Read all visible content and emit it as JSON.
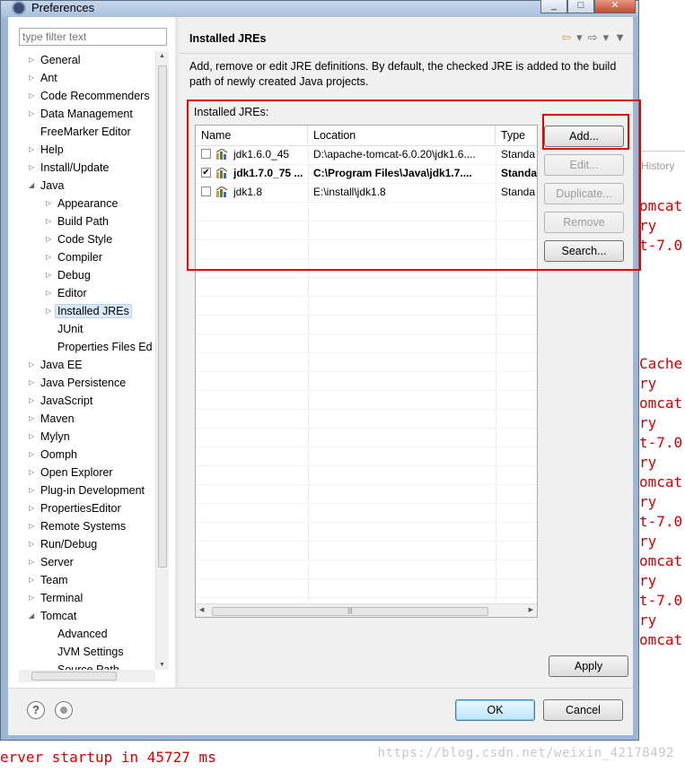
{
  "window": {
    "title": "Preferences"
  },
  "filter": {
    "placeholder": "type filter text"
  },
  "tree": {
    "items": [
      {
        "label": "General",
        "level": 0,
        "expandable": true
      },
      {
        "label": "Ant",
        "level": 0,
        "expandable": true
      },
      {
        "label": "Code Recommenders",
        "level": 0,
        "expandable": true
      },
      {
        "label": "Data Management",
        "level": 0,
        "expandable": true
      },
      {
        "label": "FreeMarker Editor",
        "level": 0,
        "expandable": false
      },
      {
        "label": "Help",
        "level": 0,
        "expandable": true
      },
      {
        "label": "Install/Update",
        "level": 0,
        "expandable": true
      },
      {
        "label": "Java",
        "level": 0,
        "expandable": true,
        "expanded": true
      },
      {
        "label": "Appearance",
        "level": 1,
        "expandable": true
      },
      {
        "label": "Build Path",
        "level": 1,
        "expandable": true
      },
      {
        "label": "Code Style",
        "level": 1,
        "expandable": true
      },
      {
        "label": "Compiler",
        "level": 1,
        "expandable": true
      },
      {
        "label": "Debug",
        "level": 1,
        "expandable": true
      },
      {
        "label": "Editor",
        "level": 1,
        "expandable": true
      },
      {
        "label": "Installed JREs",
        "level": 1,
        "expandable": true,
        "selected": true
      },
      {
        "label": "JUnit",
        "level": 1,
        "expandable": false
      },
      {
        "label": "Properties Files Ed",
        "level": 1,
        "expandable": false
      },
      {
        "label": "Java EE",
        "level": 0,
        "expandable": true
      },
      {
        "label": "Java Persistence",
        "level": 0,
        "expandable": true
      },
      {
        "label": "JavaScript",
        "level": 0,
        "expandable": true
      },
      {
        "label": "Maven",
        "level": 0,
        "expandable": true
      },
      {
        "label": "Mylyn",
        "level": 0,
        "expandable": true
      },
      {
        "label": "Oomph",
        "level": 0,
        "expandable": true
      },
      {
        "label": "Open Explorer",
        "level": 0,
        "expandable": true
      },
      {
        "label": "Plug-in Development",
        "level": 0,
        "expandable": true
      },
      {
        "label": "PropertiesEditor",
        "level": 0,
        "expandable": true
      },
      {
        "label": "Remote Systems",
        "level": 0,
        "expandable": true
      },
      {
        "label": "Run/Debug",
        "level": 0,
        "expandable": true
      },
      {
        "label": "Server",
        "level": 0,
        "expandable": true
      },
      {
        "label": "Team",
        "level": 0,
        "expandable": true
      },
      {
        "label": "Terminal",
        "level": 0,
        "expandable": true
      },
      {
        "label": "Tomcat",
        "level": 0,
        "expandable": true,
        "expanded": true
      },
      {
        "label": "Advanced",
        "level": 1,
        "expandable": false
      },
      {
        "label": "JVM Settings",
        "level": 1,
        "expandable": false
      },
      {
        "label": "Source Path",
        "level": 1,
        "expandable": false
      }
    ]
  },
  "page": {
    "title": "Installed JREs",
    "description": "Add, remove or edit JRE definitions. By default, the checked JRE is added to the build path of newly created Java projects.",
    "list_label": "Installed JREs:"
  },
  "table": {
    "headers": [
      "Name",
      "Location",
      "Type"
    ],
    "rows": [
      {
        "checked": false,
        "name": "jdk1.6.0_45",
        "location": "D:\\apache-tomcat-6.0.20\\jdk1.6....",
        "type": "Standa",
        "bold": false
      },
      {
        "checked": true,
        "name": "jdk1.7.0_75 ...",
        "location": "C:\\Program Files\\Java\\jdk1.7....",
        "type": "Standa",
        "bold": true
      },
      {
        "checked": false,
        "name": "jdk1.8",
        "location": "E:\\install\\jdk1.8",
        "type": "Standa",
        "bold": false
      }
    ]
  },
  "buttons": {
    "add": "Add...",
    "edit": "Edit...",
    "duplicate": "Duplicate...",
    "remove": "Remove",
    "search": "Search...",
    "apply": "Apply",
    "ok": "OK",
    "cancel": "Cancel"
  },
  "background": {
    "history_tab": "History",
    "console_fragments": [
      "omcat",
      "ry",
      "t-7.0",
      "Cache",
      "ry",
      "omcat",
      "ry",
      "t-7.0",
      "ry",
      "omcat",
      "ry",
      "t-7.0",
      "ry",
      "omcat",
      "ry",
      "t-7.0",
      "ry",
      "omcat"
    ],
    "bottom_line_1": "erver startup in 45727 ms",
    "watermark": "https://blog.csdn.net/weixin_42178492"
  },
  "colors": {
    "highlight": "#e00000",
    "console_text": "#d10000"
  }
}
